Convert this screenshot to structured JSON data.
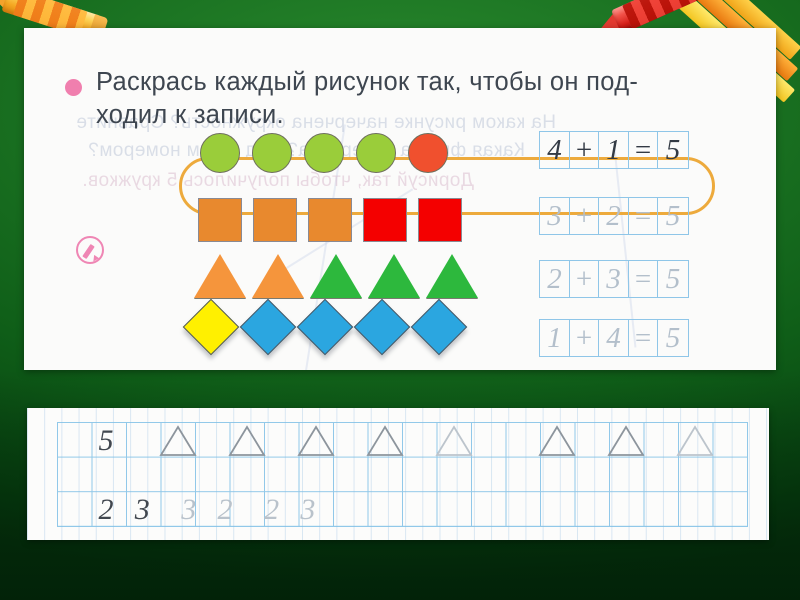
{
  "scene": {
    "background_color": "#0f5e18",
    "description_name": "chalkboard-slide"
  },
  "decorations": [
    {
      "name": "crayon-top-left",
      "color": "#f5a722"
    },
    {
      "name": "crayon-top-right",
      "color": "#d61f18"
    },
    {
      "name": "pencils-top-right",
      "colors": [
        "#f0a318",
        "#e8780f",
        "#f3c521"
      ]
    }
  ],
  "worksheet": {
    "bullet_color": "#f07fae",
    "task": {
      "line1": "Раскрась каждый рисунок так, чтобы он под-",
      "line2": "ходил к записи."
    },
    "pencil_icon_color": "#ef86b4",
    "highlight_color": "#edaa3c",
    "ghost_text": {
      "line1": "На каком рисунке начерчена окружность? Сравните",
      "line2": "Какая фигура начерчена? Под каким номером?",
      "line3": "Дорисуй так, чтобы получилось 5 кружков."
    },
    "rows": [
      {
        "name": "row-circles",
        "shape": "circle",
        "highlighted": true,
        "items": [
          {
            "color": "#9ACD3A"
          },
          {
            "color": "#9ACD3A"
          },
          {
            "color": "#9ACD3A"
          },
          {
            "color": "#9ACD3A"
          },
          {
            "color": "#F0502E"
          }
        ],
        "equation": {
          "a": "4",
          "op": "+",
          "b": "1",
          "eq": "=",
          "result": "5",
          "style": "dark",
          "text": "4+1=5"
        }
      },
      {
        "name": "row-squares",
        "shape": "square",
        "highlighted": false,
        "items": [
          {
            "color": "#E8892E"
          },
          {
            "color": "#E8892E"
          },
          {
            "color": "#E8892E"
          },
          {
            "color": "#F40000"
          },
          {
            "color": "#F40000"
          }
        ],
        "equation": {
          "a": "3",
          "op": "+",
          "b": "2",
          "eq": "=",
          "result": "5",
          "style": "light",
          "text": "3+2=5"
        }
      },
      {
        "name": "row-triangles",
        "shape": "triangle",
        "highlighted": false,
        "items": [
          {
            "color": "#F5953C"
          },
          {
            "color": "#F5953C"
          },
          {
            "color": "#2DB83D"
          },
          {
            "color": "#2DB83D"
          },
          {
            "color": "#2DB83D"
          }
        ],
        "equation": {
          "a": "2",
          "op": "+",
          "b": "3",
          "eq": "=",
          "result": "5",
          "style": "light",
          "text": "2+3=5"
        }
      },
      {
        "name": "row-diamonds",
        "shape": "diamond",
        "highlighted": false,
        "items": [
          {
            "color": "#FFF000"
          },
          {
            "color": "#2BA6E0"
          },
          {
            "color": "#2BA6E0"
          },
          {
            "color": "#2BA6E0"
          },
          {
            "color": "#2BA6E0"
          }
        ],
        "equation": {
          "a": "1",
          "op": "+",
          "b": "4",
          "eq": "=",
          "result": "5",
          "style": "light",
          "text": "1+4=5"
        }
      }
    ]
  },
  "practice_strip": {
    "name": "handwriting-practice-strip",
    "grid_color": "#7fc0e6",
    "row_top": {
      "digit": "5",
      "digit_style": "dark",
      "triangle_count": 8,
      "triangle_styles": [
        "mid",
        "mid",
        "mid",
        "mid",
        "light",
        "mid",
        "mid",
        "light"
      ]
    },
    "row_bottom": {
      "groups": [
        {
          "left": "2",
          "right": "3",
          "left_style": "dark",
          "right_style": "dark"
        },
        {
          "left": "3",
          "right": "2",
          "left_style": "light",
          "right_style": "light"
        },
        {
          "left": "2",
          "right": "3",
          "left_style": "light",
          "right_style": "light"
        }
      ]
    }
  }
}
